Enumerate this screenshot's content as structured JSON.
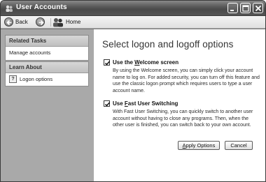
{
  "window": {
    "title": "User Accounts"
  },
  "toolbar": {
    "back_label": "Back",
    "home_label": "Home"
  },
  "sidebar": {
    "related_tasks": {
      "header": "Related Tasks",
      "items": [
        "Manage accounts"
      ]
    },
    "learn_about": {
      "header": "Learn About",
      "items": [
        "Logon options"
      ]
    }
  },
  "main": {
    "title": "Select logon and logoff options",
    "options": [
      {
        "label_prefix": "Use the ",
        "label_underlined": "W",
        "label_suffix": "elcome screen",
        "checked": true,
        "description": "By using the Welcome screen, you can simply click your account name to log on. For added security, you can turn off this feature and use the classic logon prompt which requires users to type a user account name."
      },
      {
        "label_prefix": "Use ",
        "label_underlined": "F",
        "label_suffix": "ast User Switching",
        "checked": true,
        "description": "With Fast User Switching, you can quickly switch to another user account without having to close any programs. Then, when the other user is finished, you can switch back to your own account."
      }
    ],
    "buttons": {
      "apply_prefix": "",
      "apply_underlined": "A",
      "apply_suffix": "pply Options",
      "cancel": "Cancel"
    }
  }
}
